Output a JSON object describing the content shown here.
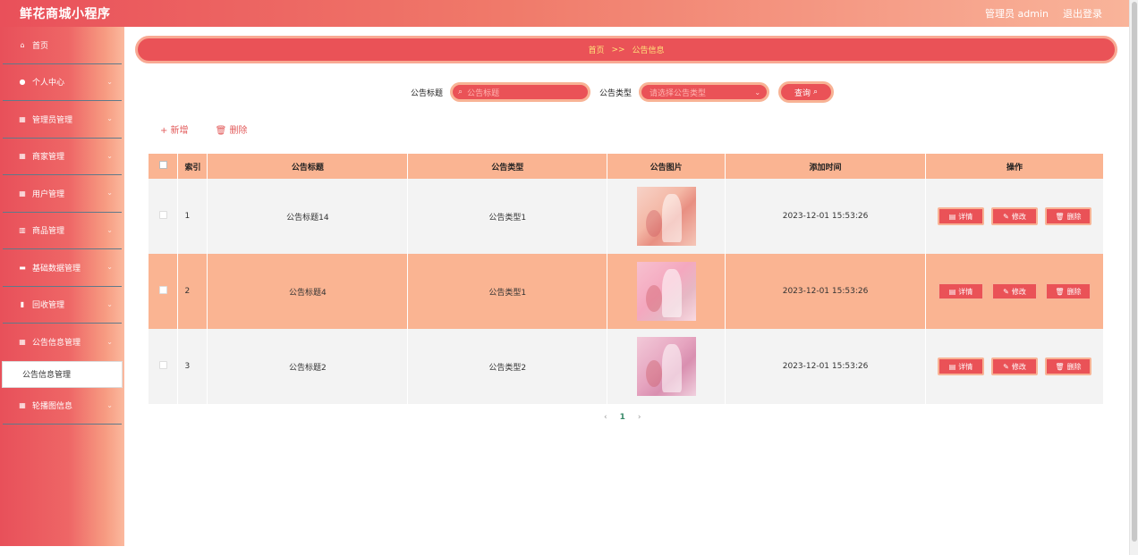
{
  "header": {
    "app_title": "鲜花商城小程序",
    "admin_label": "管理员 admin",
    "logout": "退出登录"
  },
  "sidebar": {
    "items": [
      {
        "label": "首页",
        "icon": "home-icon",
        "glyph": "⌂",
        "has_chevron": false
      },
      {
        "label": "个人中心",
        "icon": "user-icon",
        "glyph": "●",
        "has_chevron": true
      },
      {
        "label": "管理员管理",
        "icon": "grid-icon",
        "glyph": "▦",
        "has_chevron": true
      },
      {
        "label": "商家管理",
        "icon": "grid-icon",
        "glyph": "▦",
        "has_chevron": true
      },
      {
        "label": "用户管理",
        "icon": "grid-icon",
        "glyph": "▦",
        "has_chevron": true
      },
      {
        "label": "商品管理",
        "icon": "trash-icon",
        "glyph": "▥",
        "has_chevron": true
      },
      {
        "label": "基础数据管理",
        "icon": "monitor-icon",
        "glyph": "▬",
        "has_chevron": true
      },
      {
        "label": "回收管理",
        "icon": "bookmark-icon",
        "glyph": "▮",
        "has_chevron": true
      },
      {
        "label": "公告信息管理",
        "icon": "grid-icon",
        "glyph": "▦",
        "has_chevron": true
      }
    ],
    "submenu_label": "公告信息管理",
    "last_item": {
      "label": "轮播图信息",
      "icon": "grid-icon",
      "glyph": "▦"
    }
  },
  "breadcrumb": {
    "home": "首页",
    "sep": ">>",
    "current": "公告信息"
  },
  "search": {
    "title_label": "公告标题",
    "title_placeholder": "公告标题",
    "type_label": "公告类型",
    "type_placeholder": "请选择公告类型",
    "query_label": "查询"
  },
  "actions": {
    "add": "+ 新增",
    "delete": "删除"
  },
  "table": {
    "columns": [
      "索引",
      "公告标题",
      "公告类型",
      "公告图片",
      "添加时间",
      "操作"
    ],
    "rows": [
      {
        "index": "1",
        "title": "公告标题14",
        "type": "公告类型1",
        "time": "2023-12-01 15:53:26"
      },
      {
        "index": "2",
        "title": "公告标题4",
        "type": "公告类型1",
        "time": "2023-12-01 15:53:26"
      },
      {
        "index": "3",
        "title": "公告标题2",
        "type": "公告类型2",
        "time": "2023-12-01 15:53:26"
      }
    ],
    "buttons": {
      "detail": "详情",
      "edit": "修改",
      "delete": "删除"
    }
  },
  "pager": {
    "prev": "‹",
    "current": "1",
    "next": "›"
  },
  "colors": {
    "accent": "#ea5257",
    "header_peach": "#fab492",
    "light_row": "#f3f3f3"
  }
}
